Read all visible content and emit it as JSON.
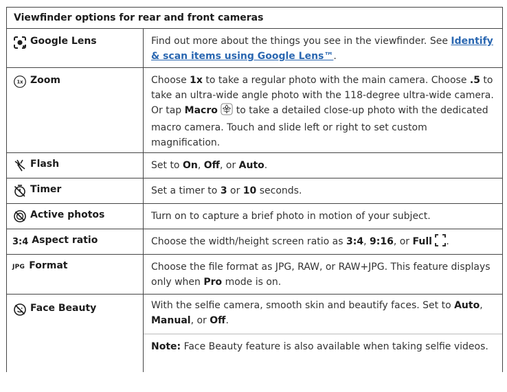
{
  "header": "Viewfinder options for rear and front cameras",
  "rows": [
    {
      "label": "Google Lens",
      "icon": "google-lens-icon",
      "text_a": "Find out more about the things you see in the viewfinder. See ",
      "link": "Identify & scan items using Google Lens™",
      "text_b": "."
    },
    {
      "label": "Zoom",
      "icon": "zoom-1x-icon",
      "icon_text": "1x",
      "p1": "Choose ",
      "b1": "1x",
      "p2": " to take a regular photo with the main camera. Choose ",
      "b2": ".5",
      "p3": " to take an ultra-wide angle photo with the 118-degree ultra-wide camera. Or tap ",
      "b3": "Macro",
      "p4": " to take a detailed close-up photo with the dedicated macro camera. Touch and slide left or right to set custom magnification."
    },
    {
      "label": "Flash",
      "icon": "flash-off-icon",
      "p1": "Set to ",
      "b1": "On",
      "p2": ", ",
      "b2": "Off",
      "p3": ", or ",
      "b3": "Auto",
      "p4": "."
    },
    {
      "label": "Timer",
      "icon": "timer-off-icon",
      "p1": "Set a timer to ",
      "b1": "3",
      "p2": " or ",
      "b2": "10",
      "p3": " seconds."
    },
    {
      "label": "Active photos",
      "icon": "active-photos-off-icon",
      "text": "Turn on to capture a brief photo in motion of your subject."
    },
    {
      "label": "Aspect ratio",
      "icon_text": "3:4",
      "p1": "Choose the width/height screen ratio as ",
      "b1": "3:4",
      "p2": ", ",
      "b2": "9:16",
      "p3": ", or ",
      "b3": "Full",
      "p4": "."
    },
    {
      "label": "Format",
      "icon_text": "JPG",
      "p1": "Choose the file format as JPG, RAW, or RAW+JPG. This feature displays only when ",
      "b1": "Pro",
      "p2": " mode is on."
    },
    {
      "label": "Face Beauty",
      "icon": "face-beauty-off-icon",
      "p1": "With the selfie camera, smooth skin and beautify faces. Set to ",
      "b1": "Auto",
      "p2": ", ",
      "b2": "Manual",
      "p3": ", or ",
      "b3": "Off",
      "p4": ".",
      "note_label": "Note:",
      "note_text": " Face Beauty feature is also available when taking selfie videos."
    }
  ]
}
